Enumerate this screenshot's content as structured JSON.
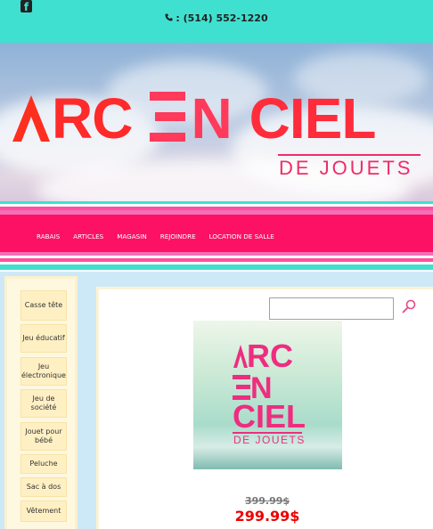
{
  "header": {
    "facebook_icon": "facebook-icon",
    "phone_icon": "phone-icon",
    "phone_text": ": (514) 552-1220"
  },
  "banner": {
    "logo_line1_a": "A",
    "logo_line1_rc": "RC",
    "logo_line1_en": "EN",
    "logo_line1_ciel": "CIEL",
    "logo_line2": "DE JOUETS"
  },
  "nav": {
    "items": [
      {
        "label": "RABAIS"
      },
      {
        "label": "ARTICLES"
      },
      {
        "label": "MAGASIN"
      },
      {
        "label": "REJOINDRE"
      },
      {
        "label": "LOCATION DE SALLE"
      }
    ]
  },
  "sidebar": {
    "categories": [
      {
        "label": "Casse tête"
      },
      {
        "label": "Jeu éducatif"
      },
      {
        "label": "Jeu électronique"
      },
      {
        "label": "Jeu de société"
      },
      {
        "label": "Jouet pour bébé"
      },
      {
        "label": "Peluche"
      },
      {
        "label": "Sac à dos"
      },
      {
        "label": "Vêtement"
      }
    ]
  },
  "search": {
    "value": "",
    "placeholder": ""
  },
  "product": {
    "image_logo_line1": "ARC",
    "image_logo_line2": "EN",
    "image_logo_line3": "CIEL",
    "image_logo_line4": "DE JOUETS",
    "old_price": "399.99$",
    "new_price": "299.99$"
  },
  "colors": {
    "topbar": "#40e0d0",
    "nav": "#fc1164",
    "price": "#ee0000",
    "logo": "#ff2a2a"
  }
}
